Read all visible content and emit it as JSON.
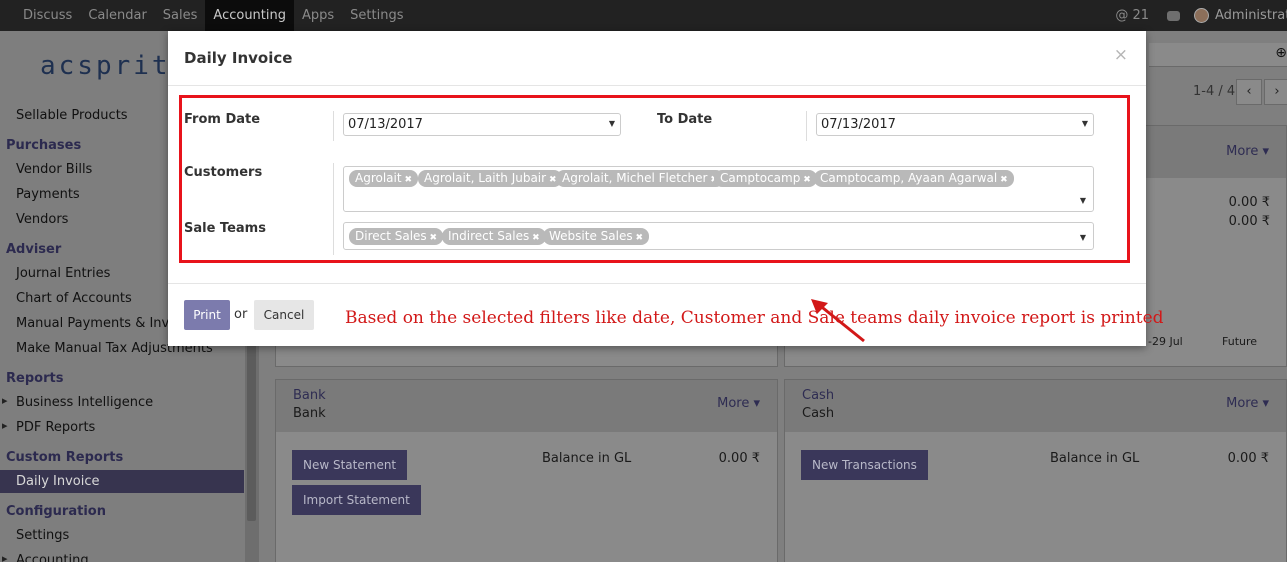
{
  "topbar": {
    "menu": [
      "Discuss",
      "Calendar",
      "Sales",
      "Accounting",
      "Apps",
      "Settings"
    ],
    "active": "Accounting",
    "mentions": "@ 21",
    "user": "Administrator"
  },
  "sidebar": {
    "logo": "acsprit",
    "items": {
      "sellable_products": "Sellable Products",
      "purchases": "Purchases",
      "vendor_bills": "Vendor Bills",
      "payments": "Payments",
      "vendors": "Vendors",
      "adviser": "Adviser",
      "journal_entries": "Journal Entries",
      "chart_of_accounts": "Chart of Accounts",
      "manual_payments": "Manual Payments & Invoice Matching",
      "manual_tax": "Make Manual Tax Adjustments",
      "reports": "Reports",
      "business_intelligence": "Business Intelligence",
      "pdf_reports": "PDF Reports",
      "custom_reports": "Custom Reports",
      "daily_invoice": "Daily Invoice",
      "configuration": "Configuration",
      "settings": "Settings",
      "accounting": "Accounting"
    }
  },
  "main": {
    "pager": "1-4 / 4",
    "pager_prev": "‹",
    "pager_next": "›",
    "top_cards": {
      "more": "More ▾",
      "amount1": "0.00 ₹",
      "amount2": "0.00 ₹",
      "partial_label": "o",
      "axis_date": "-29 Jul",
      "axis_future": "Future"
    },
    "bank": {
      "title": "Bank",
      "subtitle": "Bank",
      "more": "More ▾",
      "btn_new": "New Statement",
      "btn_import": "Import Statement",
      "balance_label": "Balance in GL",
      "balance_value": "0.00 ₹"
    },
    "cash": {
      "title": "Cash",
      "subtitle": "Cash",
      "more": "More ▾",
      "btn_new": "New Transactions",
      "balance_label": "Balance in GL",
      "balance_value": "0.00 ₹"
    }
  },
  "modal": {
    "title": "Daily Invoice",
    "close": "×",
    "from_date_label": "From Date",
    "from_date_value": "07/13/2017",
    "to_date_label": "To Date",
    "to_date_value": "07/13/2017",
    "customers_label": "Customers",
    "customers": [
      "Agrolait",
      "Agrolait, Laith Jubair",
      "Agrolait, Michel Fletcher",
      "Camptocamp",
      "Camptocamp, Ayaan Agarwal"
    ],
    "sale_teams_label": "Sale Teams",
    "sale_teams": [
      "Direct Sales",
      "Indirect Sales",
      "Website Sales"
    ],
    "print_label": "Print",
    "or_label": "or",
    "cancel_label": "Cancel",
    "annotation": "Based on the selected filters like date, Customer and Sale teams daily invoice report is printed"
  }
}
